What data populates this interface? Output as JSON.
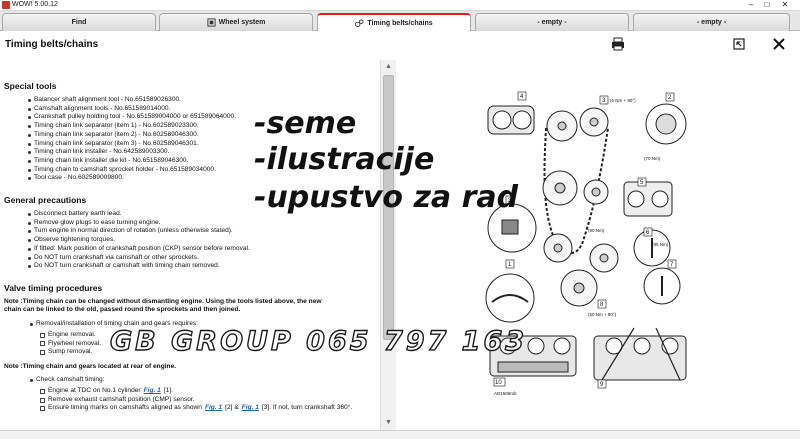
{
  "window": {
    "title": "WOW! 5.00.12",
    "minimize": "–",
    "maximize": "□",
    "close": "✕"
  },
  "tabs": [
    {
      "label": "Find",
      "active": false
    },
    {
      "label": "Wheel system",
      "active": false,
      "icon": "wheel-system-icon"
    },
    {
      "label": "Timing belts/chains",
      "active": true,
      "icon": "timing-belt-icon"
    },
    {
      "label": "- empty -",
      "active": false
    },
    {
      "label": "- empty -",
      "active": false
    }
  ],
  "header": {
    "title": "Timing belts/chains",
    "icons": [
      "print-icon",
      "restore-window-icon",
      "close-icon"
    ]
  },
  "content": {
    "special_tools": {
      "title": "Special tools",
      "items": [
        "Balancer shaft alignment tool - No.651589026300.",
        "Camshaft alignment tools - No.651589014000.",
        "Crankshaft pulley holding tool - No.651589004000 or 651589064000.",
        "Timing chain link separator (item 1) - No.602589023300.",
        "Timing chain link separator (item 2) - No.602589046300.",
        "Timing chain link separator (item 3) - No.602589046301.",
        "Timing chain link installer - No.642589003300.",
        "Timing chain link installer die kit - No.651589046300.",
        "Timing chain to camshaft sprocket holder - No.651589034000.",
        "Tool case - No.602589009800."
      ]
    },
    "general_precautions": {
      "title": "General precautions",
      "items": [
        "Disconnect battery earth lead.",
        "Remove glow plugs to ease turning engine.",
        "Turn engine in normal direction of rotation (unless otherwise stated).",
        "Observe tightening torques.",
        "If fitted: Mark position of crankshaft position (CKP) sensor before removal.",
        "Do NOT turn crankshaft via camshaft or other sprockets.",
        "Do NOT turn crankshaft or camshaft with timing chain removed."
      ]
    },
    "valve_timing": {
      "title": "Valve timing procedures",
      "note1_line1": "Note :Timing chain can be changed without dismantling engine. Using the tools listed above, the new",
      "note1_line2": "chain can be linked to the old, passed round the sprockets and then joined.",
      "step1": "Removal/installation of timing chain and gears requires:",
      "step1_items": [
        "Engine removal.",
        "Flywheel removal.",
        "Sump removal."
      ],
      "note2": "Note :Timing chain and gears located at rear of engine.",
      "step2": "Check camshaft timing:",
      "check1_text": "Engine at TDC on No.1 cylinder",
      "check1_fig": "Fig. 1",
      "check1_ref": "[1].",
      "check2_text": "Remove exhaust camshaft position (CMP) sensor.",
      "check3_text": "Ensure timing marks on camshafts aligned as shown",
      "check3_fig1": "Fig. 1",
      "check3_ref1": "[2] &",
      "check3_fig2": "Fig. 1",
      "check3_ref2": "[3]. If not, turn crankshaft 360°."
    }
  },
  "overlay": {
    "line1": "-seme",
    "line2": "-ilustracije",
    "line3": "-upustvo za rad",
    "watermark": "GB GROUP 065 797 163"
  },
  "illustration": {
    "callouts": [
      "4",
      "3",
      "2",
      "5",
      "6",
      "3",
      "1",
      "7",
      "8",
      "9",
      "10",
      "2",
      "1"
    ],
    "labels": [
      "(5 Nm + 90°)",
      "(70 Nm)",
      "(90 Nm)",
      "(95 Nm)",
      "(50 Nm + 90°)",
      "AD1506mb"
    ]
  },
  "colors": {
    "active_tab_accent": "#e0201b",
    "link": "#1f5fbf"
  }
}
